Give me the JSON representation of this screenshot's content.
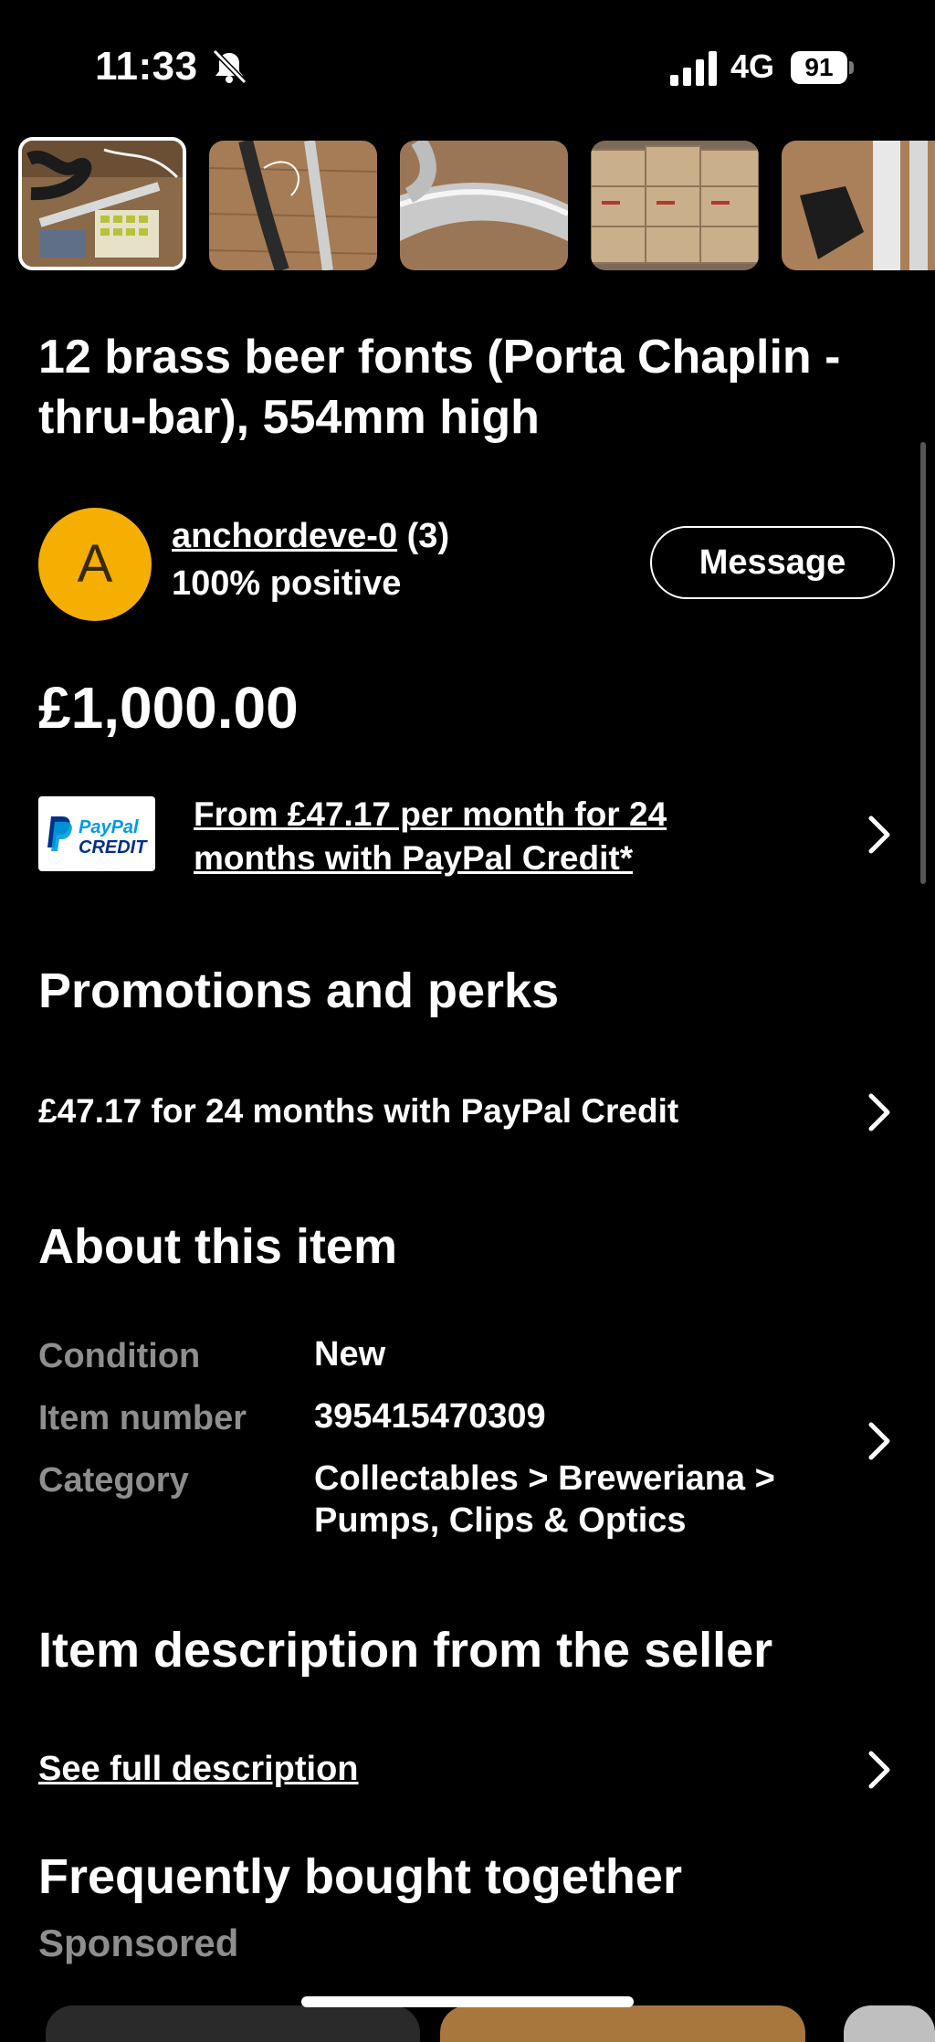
{
  "status_bar": {
    "time": "11:33",
    "network": "4G",
    "battery": "91"
  },
  "gallery": {
    "thumbnail_count_visible": 5,
    "selected_index": 0
  },
  "listing": {
    "title": "12 brass beer fonts (Porta Chaplin - thru-bar), 554mm high",
    "price": "£1,000.00"
  },
  "seller": {
    "avatar_letter": "A",
    "name": "anchordeve-0",
    "feedback_count": "(3)",
    "feedback": "100% positive",
    "message_label": "Message"
  },
  "paypal": {
    "logo_line1": "PayPal",
    "logo_line2": "CREDIT",
    "offer": "From £47.17 per month for 24 months with PayPal Credit*"
  },
  "promotions": {
    "heading": "Promotions and perks",
    "item": "£47.17 for 24 months with PayPal Credit"
  },
  "about": {
    "heading": "About this item",
    "condition_label": "Condition",
    "condition_value": "New",
    "item_number_label": "Item number",
    "item_number_value": "395415470309",
    "category_label": "Category",
    "category_line1": "Collectables > Breweriana >",
    "category_line2": "Pumps, Clips & Optics"
  },
  "description": {
    "heading": "Item description from the seller",
    "link": "See full description"
  },
  "frequently_bought": {
    "heading": "Frequently bought together",
    "sponsored": "Sponsored"
  },
  "colors": {
    "background": "#000000",
    "text": "#ffffff",
    "muted": "#8e8e8e",
    "avatar": "#f5af02",
    "paypal_blue": "#003087",
    "paypal_light_blue": "#009cde"
  },
  "icons": [
    "bell-slash-icon",
    "signal-icon",
    "battery-icon",
    "chevron-right-icon"
  ]
}
